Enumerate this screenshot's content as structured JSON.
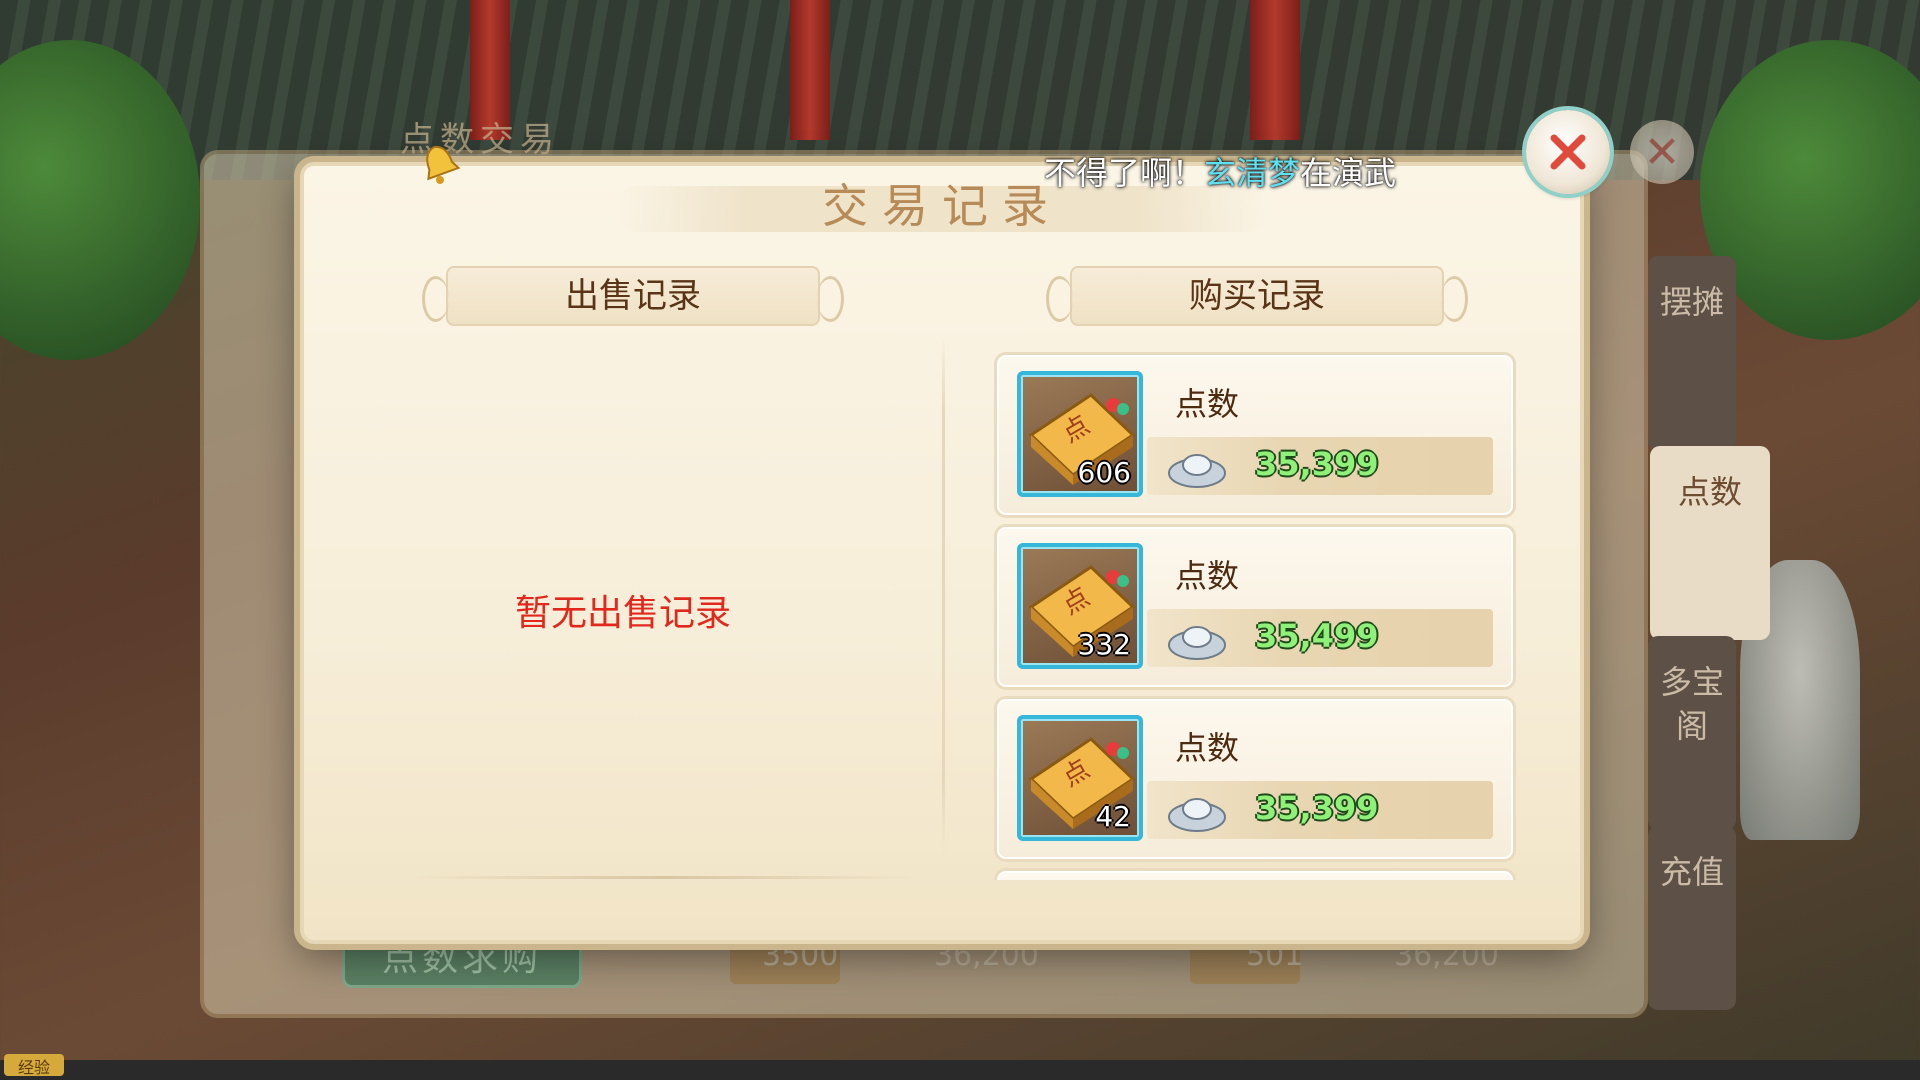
{
  "background": {
    "panel_title": "点数交易",
    "side_tabs": [
      "摆摊",
      "点数",
      "多宝阁",
      "充值"
    ],
    "buy_request_button": "点数求购",
    "listings": [
      {
        "quantity": "3500",
        "price": "36,200"
      },
      {
        "quantity": "501",
        "price": "36,200"
      }
    ],
    "exp_badge": "经验"
  },
  "marquee": {
    "prefix": "不得了啊！",
    "player_name": "玄清梦",
    "suffix": "在演武"
  },
  "modal": {
    "title": "交易记录",
    "sell_header": "出售记录",
    "buy_header": "购买记录",
    "empty_sell_message": "暂无出售记录",
    "buy_records": [
      {
        "item_name": "点数",
        "quantity": "606",
        "price": "35,399"
      },
      {
        "item_name": "点数",
        "quantity": "332",
        "price": "35,499"
      },
      {
        "item_name": "点数",
        "quantity": "42",
        "price": "35,399"
      }
    ]
  },
  "colors": {
    "accent_teal": "#36b6d8",
    "price_green": "#8ff07a",
    "empty_red": "#e0281c",
    "close_red": "#e04a3c"
  },
  "icons": [
    "bell-icon",
    "close-icon",
    "points-ticket-icon",
    "silver-ingot-icon"
  ]
}
